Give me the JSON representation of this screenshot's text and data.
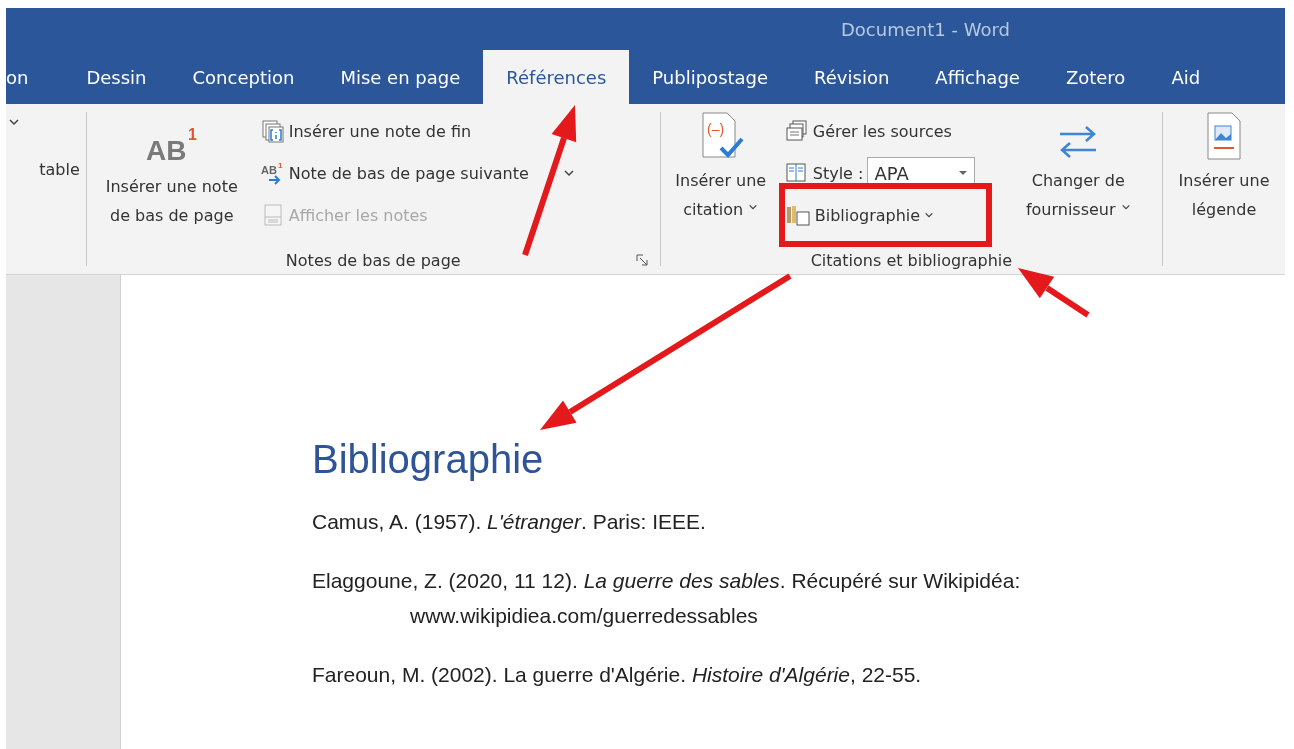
{
  "window": {
    "title": "Document1  -  Word"
  },
  "tabs": [
    {
      "label": "on",
      "selected": false
    },
    {
      "label": "Dessin",
      "selected": false
    },
    {
      "label": "Conception",
      "selected": false
    },
    {
      "label": "Mise en page",
      "selected": false
    },
    {
      "label": "Références",
      "selected": true
    },
    {
      "label": "Publipostage",
      "selected": false
    },
    {
      "label": "Révision",
      "selected": false
    },
    {
      "label": "Affichage",
      "selected": false
    },
    {
      "label": "Zotero",
      "selected": false
    },
    {
      "label": "Aid",
      "selected": false
    }
  ],
  "ribbon": {
    "cut_group": {
      "label": "table"
    },
    "footnotes": {
      "label": "Notes de bas de page",
      "big_button": {
        "icon_text": "AB",
        "icon_mark": "1",
        "lines": [
          "Insérer une note",
          "de bas de page"
        ]
      },
      "small_buttons": [
        {
          "kind": "endnote",
          "label": "Insérer une note de fin",
          "disabled": false
        },
        {
          "kind": "next",
          "label": "Note de bas de page suivante",
          "icon_text": "AB",
          "icon_mark": "1",
          "disabled": false
        },
        {
          "kind": "show",
          "label": "Afficher les notes",
          "disabled": true
        }
      ]
    },
    "citations": {
      "label": "Citations et bibliographie",
      "insert_citation": {
        "icon_text": "(–)",
        "lines": [
          "Insérer une",
          "citation"
        ]
      },
      "manage_sources": "Gérer les sources",
      "style_label": "Style :",
      "style_value": "APA",
      "bibliography": "Bibliographie",
      "switch_provider": {
        "lines": [
          "Changer de",
          "fournisseur"
        ]
      }
    },
    "captions": {
      "lines": [
        "Insérer une",
        "légende"
      ]
    }
  },
  "document": {
    "heading": "Bibliographie",
    "entries": [
      {
        "lines": [
          "Camus, A. (1957). *L'étranger*. Paris: IEEE."
        ]
      },
      {
        "lines": [
          "Elaggoune, Z. (2020, 11 12). *La guerre des sables*. Récupéré sur Wikipidéa:",
          "www.wikipidiea.com/guerredessables"
        ]
      },
      {
        "lines": [
          "Fareoun, M. (2002). La guerre d'Algérie. *Histoire d'Algérie*, 22-55."
        ]
      }
    ]
  }
}
